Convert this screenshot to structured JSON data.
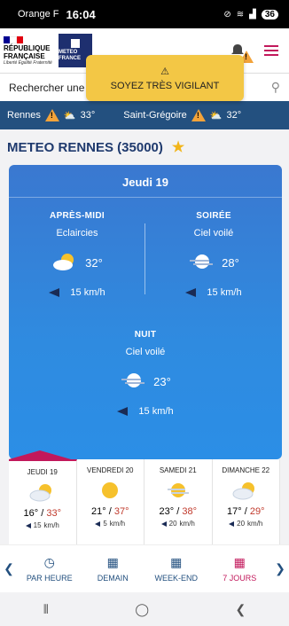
{
  "status": {
    "carrier": "Orange F",
    "time": "16:04",
    "battery": "36"
  },
  "header": {
    "rf_title": "RÉPUBLIQUE FRANÇAISE",
    "rf_motto": "Liberté Égalité Fraternité",
    "mf_label": "METEO FRANCE"
  },
  "search": {
    "text": "Rechercher une v"
  },
  "vigilance_popup": {
    "text": "SOYEZ TRÈS VIGILANT"
  },
  "citybar": [
    {
      "name": "Rennes",
      "temp": "33°"
    },
    {
      "name": "Saint-Grégoire",
      "temp": "32°"
    }
  ],
  "title": "METEO RENNES (35000)",
  "forecast": {
    "day": "Jeudi 19",
    "periods": [
      {
        "name": "APRÈS-MIDI",
        "desc": "Eclaircies",
        "temp": "32°",
        "wind": "15",
        "unit": "km/h",
        "icon": "partly-sunny-icon"
      },
      {
        "name": "SOIRÉE",
        "desc": "Ciel voilé",
        "temp": "28°",
        "wind": "15",
        "unit": "km/h",
        "icon": "veiled-moon-icon"
      },
      {
        "name": "NUIT",
        "desc": "Ciel voilé",
        "temp": "23°",
        "wind": "15",
        "unit": "km/h",
        "icon": "veiled-moon-icon"
      }
    ]
  },
  "days": [
    {
      "name": "JEUDI 19",
      "min": "16°",
      "max": "33°",
      "wind": "15",
      "unit": "km/h",
      "icon": "partly-sunny-icon"
    },
    {
      "name": "VENDREDI 20",
      "min": "21°",
      "max": "37°",
      "wind": "5",
      "unit": "km/h",
      "icon": "sun-icon"
    },
    {
      "name": "SAMEDI 21",
      "min": "23°",
      "max": "38°",
      "wind": "20",
      "unit": "km/h",
      "icon": "veiled-sun-icon"
    },
    {
      "name": "DIMANCHE 22",
      "min": "17°",
      "max": "29°",
      "wind": "20",
      "unit": "km/h",
      "icon": "partly-sunny-icon"
    }
  ],
  "nav": [
    {
      "label": "PAR HEURE",
      "icon": "clock-icon"
    },
    {
      "label": "DEMAIN",
      "icon": "calendar-icon"
    },
    {
      "label": "WEEK-END",
      "icon": "calendar-icon"
    },
    {
      "label": "7 JOURS",
      "icon": "calendar-icon"
    }
  ],
  "colors": {
    "accent": "#c2185b",
    "navy": "#23507f",
    "vigilance": "#f3c745"
  }
}
